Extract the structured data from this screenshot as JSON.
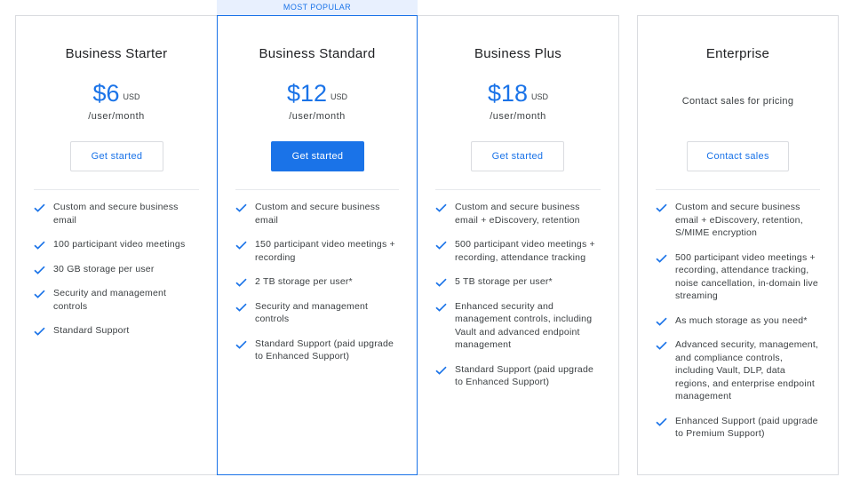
{
  "badge": "MOST POPULAR",
  "plans": [
    {
      "name": "Business Starter",
      "price": "$6",
      "currency": "USD",
      "period": "/user/month",
      "button": "Get started",
      "features": [
        "Custom and secure business email",
        "100 participant video meetings",
        "30 GB storage per user",
        "Security and management controls",
        "Standard Support"
      ]
    },
    {
      "name": "Business Standard",
      "price": "$12",
      "currency": "USD",
      "period": "/user/month",
      "button": "Get started",
      "features": [
        "Custom and secure business email",
        "150 participant video meetings + recording",
        "2 TB storage per user*",
        "Security and management controls",
        "Standard Support (paid upgrade to Enhanced Support)"
      ]
    },
    {
      "name": "Business Plus",
      "price": "$18",
      "currency": "USD",
      "period": "/user/month",
      "button": "Get started",
      "features": [
        "Custom and secure business email + eDiscovery, retention",
        "500 participant video meetings + recording, attendance tracking",
        "5 TB storage per user*",
        "Enhanced security and management controls, including Vault and advanced endpoint management",
        "Standard Support (paid upgrade to Enhanced Support)"
      ]
    },
    {
      "name": "Enterprise",
      "contact_text": "Contact sales for pricing",
      "button": "Contact sales",
      "features": [
        "Custom and secure business email + eDiscovery, retention, S/MIME encryption",
        "500 participant video meetings + recording, attendance tracking, noise cancellation, in-domain live streaming",
        "As much storage as you need*",
        "Advanced security, management, and compliance controls, including Vault, DLP, data regions, and enterprise endpoint management",
        "Enhanced Support (paid upgrade to Premium Support)"
      ]
    }
  ],
  "colors": {
    "accent": "#1a73e8",
    "badge_bg": "#e8f0fe",
    "border": "#dadce0"
  },
  "icons": {
    "feature": "check-icon"
  }
}
